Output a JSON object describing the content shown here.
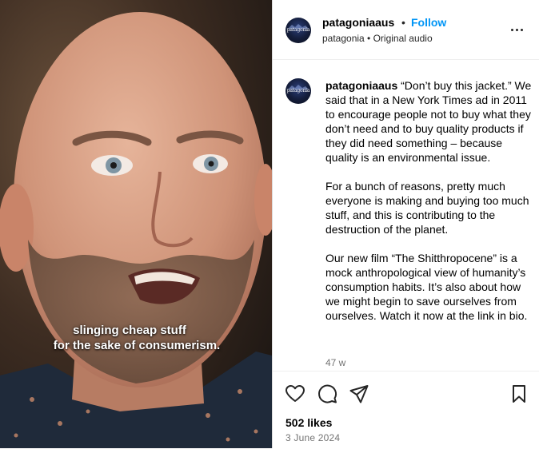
{
  "video": {
    "caption_line1": "slinging cheap stuff",
    "caption_line2": "for the sake of consumerism."
  },
  "post_header": {
    "username": "patagoniaaus",
    "separator": "•",
    "follow_label": "Follow",
    "subtitle": "patagonia • Original audio",
    "avatar_logo_text": "patagonia"
  },
  "caption": {
    "username": "patagoniaaus",
    "paragraph1": "“Don’t buy this jacket.” We said that in a New York Times ad in 2011 to encourage people not to buy what they don’t need and to buy quality products if they did need something – because quality is an environmental issue.",
    "paragraph2": "For a bunch of reasons, pretty much everyone is making and buying too much stuff, and this is contributing to the destruction of the planet.",
    "paragraph3": "Our new film “The Shitthropocene” is a mock anthropological view of humanity’s consumption habits. It’s also about how we might begin to save ourselves from ourselves. Watch it now at the link in bio.",
    "age": "47 w"
  },
  "actions": {
    "icons": [
      "heart-icon",
      "comment-icon",
      "share-icon",
      "bookmark-icon"
    ],
    "likes": "502 likes",
    "date": "3 June 2024"
  },
  "colors": {
    "accent": "#0095f6",
    "muted": "#737373",
    "border": "#dbdbdb"
  }
}
